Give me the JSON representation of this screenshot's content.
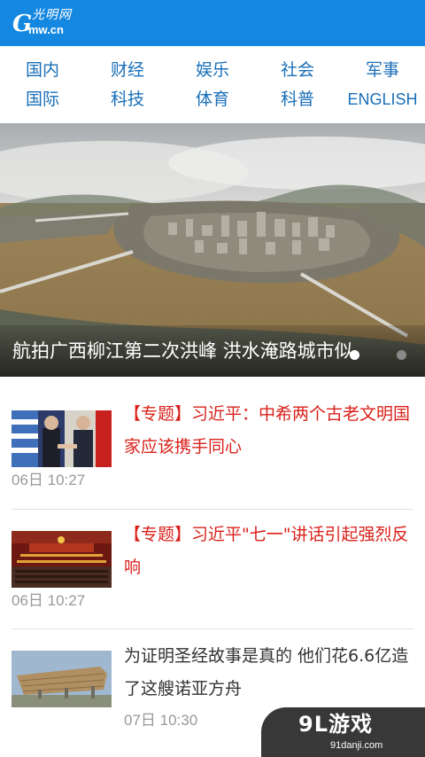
{
  "header": {
    "logo_text": "光明网",
    "logo_domain": "Gmw.cn",
    "bg_color": "#1487e0"
  },
  "nav": {
    "row1": [
      "国内",
      "财经",
      "娱乐",
      "社会",
      "军事"
    ],
    "row2": [
      "国际",
      "科技",
      "体育",
      "科普",
      "ENGLISH"
    ]
  },
  "hero": {
    "caption": "航拍广西柳江第二次洪峰 洪水淹路城市似",
    "slides_count": 2,
    "active_slide": 1
  },
  "articles": [
    {
      "tag": "【专题】",
      "title": "习近平：中希两个古老文明国家应该携手同心",
      "time": "06日 10:27",
      "highlight": true,
      "thumb_icon": "photo-leaders-handshake"
    },
    {
      "tag": "【专题】",
      "title": "习近平\"七一\"讲话引起强烈反响",
      "time": "06日 10:27",
      "highlight": true,
      "thumb_icon": "photo-conference-hall"
    },
    {
      "tag": "",
      "title": "为证明圣经故事是真的 他们花6.6亿造了这艘诺亚方舟",
      "time": "07日 10:30",
      "highlight": false,
      "thumb_icon": "photo-wooden-ark"
    }
  ],
  "watermark": {
    "main": "9L游戏",
    "sub": "91danji.com"
  }
}
